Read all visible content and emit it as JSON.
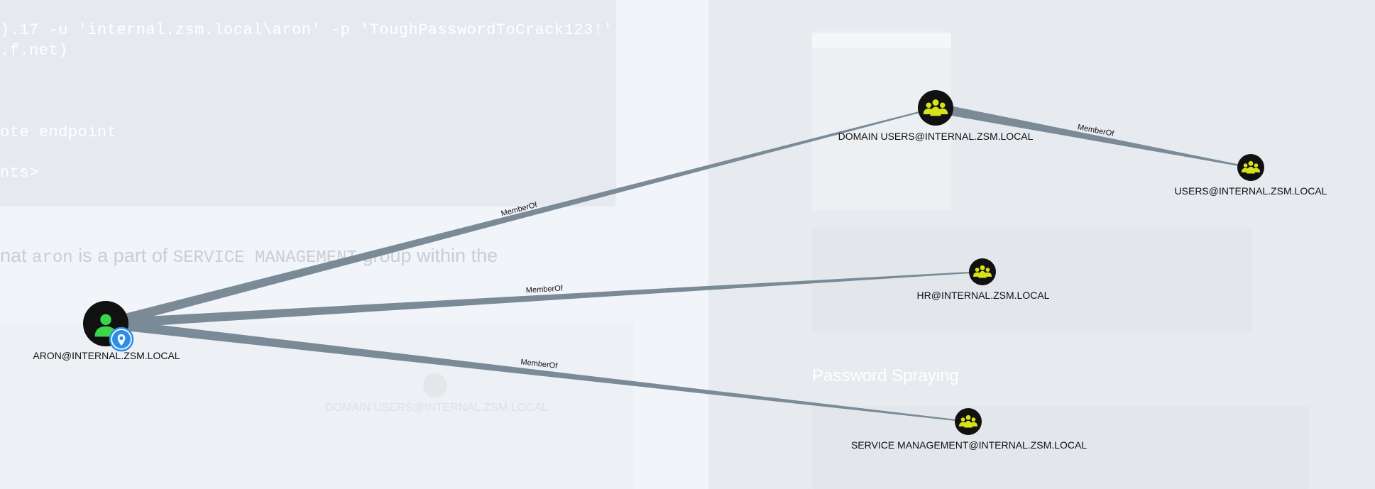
{
  "background": {
    "code_lines": [
      ").17 -u 'internal.zsm.local\\aron' -p 'ToughPasswordToCrack123!'",
      ".f.net)",
      "ote endpoint",
      "nts>"
    ],
    "prose_parts": [
      "nat ",
      "aron",
      " is a part of ",
      "SERVICE MANAGEMENT",
      " group within the"
    ],
    "heading": "Password Spraying",
    "ghost_label": "DOMAIN USERS@INTERNAL.ZSM.LOCAL"
  },
  "graph": {
    "colors": {
      "edge": "#7a8a96",
      "node_bg": "#111111",
      "user_icon": "#39d84b",
      "group_icon": "#d8e21a",
      "pin": "#2e8ee6",
      "label": "#111111"
    },
    "nodes": [
      {
        "id": "aron",
        "label": "ARON@INTERNAL.ZSM.LOCAL",
        "kind": "user",
        "icon": "user-icon",
        "owned_marker": "map-pin-icon"
      },
      {
        "id": "domain_users",
        "label": "DOMAIN USERS@INTERNAL.ZSM.LOCAL",
        "kind": "group",
        "icon": "group-icon"
      },
      {
        "id": "users",
        "label": "USERS@INTERNAL.ZSM.LOCAL",
        "kind": "group",
        "icon": "group-icon"
      },
      {
        "id": "hr",
        "label": "HR@INTERNAL.ZSM.LOCAL",
        "kind": "group",
        "icon": "group-icon"
      },
      {
        "id": "service_mgmt",
        "label": "SERVICE MANAGEMENT@INTERNAL.ZSM.LOCAL",
        "kind": "group",
        "icon": "group-icon"
      }
    ],
    "edges": [
      {
        "source": "aron",
        "target": "domain_users",
        "label": "MemberOf"
      },
      {
        "source": "aron",
        "target": "hr",
        "label": "MemberOf"
      },
      {
        "source": "aron",
        "target": "service_mgmt",
        "label": "MemberOf"
      },
      {
        "source": "domain_users",
        "target": "users",
        "label": "MemberOf"
      }
    ]
  }
}
